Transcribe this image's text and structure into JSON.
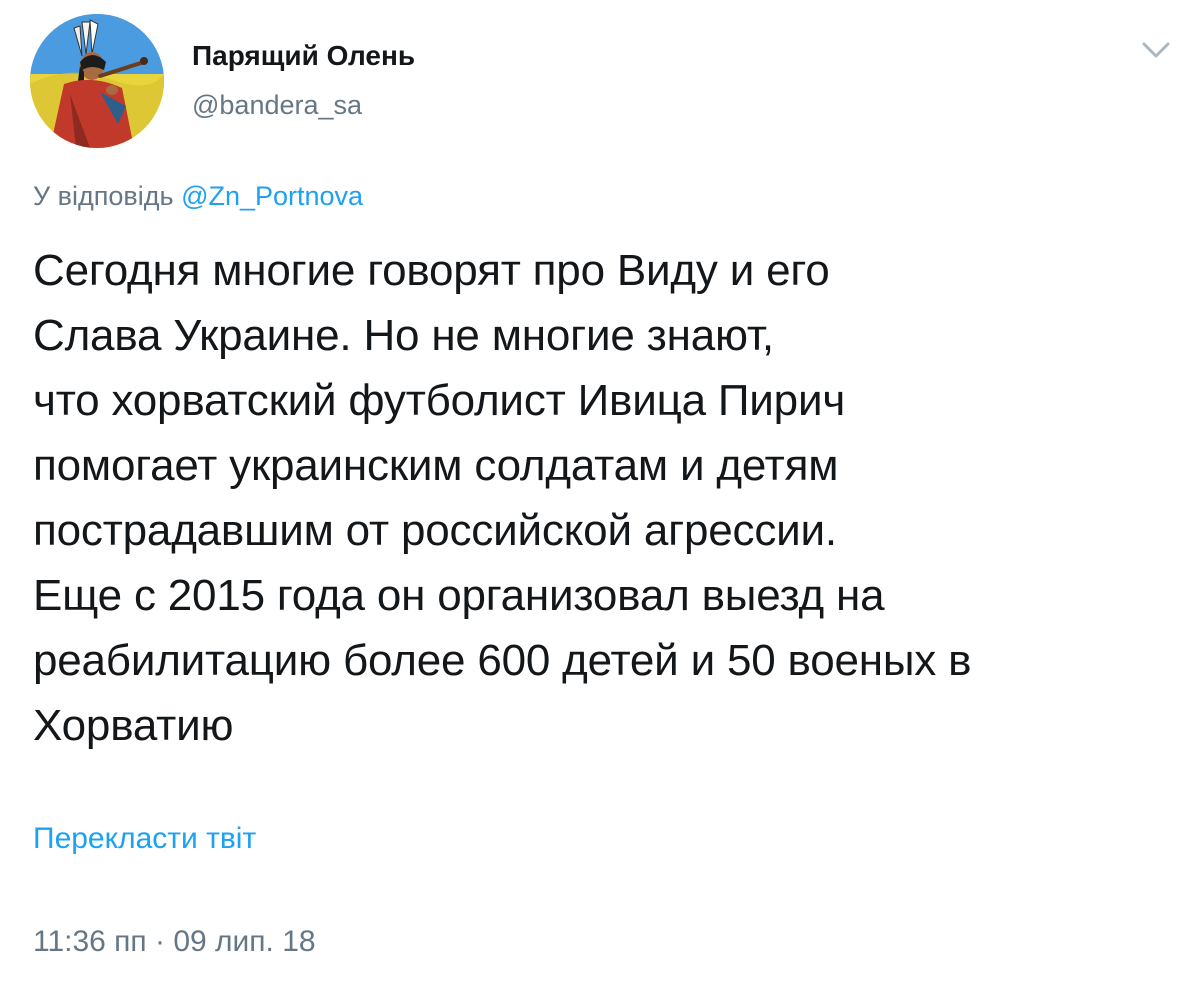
{
  "author": {
    "display_name": "Парящий Олень",
    "handle": "@bandera_sa",
    "avatar_icon": "avatar-native-chief-with-pipe"
  },
  "menu": {
    "icon": "chevron-down-icon"
  },
  "reply": {
    "prefix": "У відповідь",
    "to": "@Zn_Portnova"
  },
  "tweet": {
    "text": "Сегодня многие говорят про Виду и его\nСлава Украине. Но не многие знают,\nчто хорватский футболист Ивица Пирич\nпомогает украинским солдатам и детям\nпострадавшим от российской агрессии.\nЕще с 2015 года  он организовал выезд на\nреабилитацию более 600 детей и 50 военых в\nХорватию",
    "translate_label": "Перекласти твіт",
    "timestamp": "11:36 пп · 09 лип. 18"
  },
  "colors": {
    "text": "#14171a",
    "secondary": "#657786",
    "link": "#1da1f2",
    "background": "#ffffff"
  }
}
